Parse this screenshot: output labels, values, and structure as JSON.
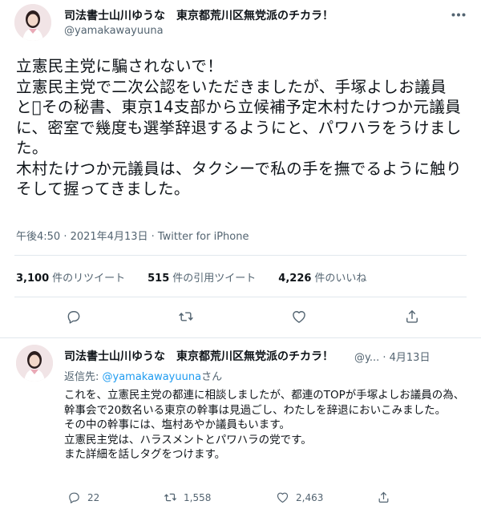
{
  "main": {
    "display_name": "司法書士山川ゆうな　東京都荒川区無党派のチカラ！",
    "handle": "@yamakawayuuna",
    "text": "立憲民主党に騙されないで！\n立憲民主党で二次公認をいただきましたが、手塚よしお議員と\u0000その秘書、東京14支部から立候補予定木村たけつか元議員に、密室で幾度も選挙辞退するようにと、パワハラをうけました。\n木村たけつか元議員は、タクシーで私の手を撫でるように触りそして握ってきました。",
    "meta": "午後4:50 · 2021年4月13日 · Twitter for iPhone",
    "stats": {
      "retweets_count": "3,100",
      "retweets_label": "件のリツイート",
      "quotes_count": "515",
      "quotes_label": "件の引用ツイート",
      "likes_count": "4,226",
      "likes_label": "件のいいね"
    },
    "actions": [
      "reply-icon",
      "retweet-icon",
      "like-icon",
      "share-icon"
    ]
  },
  "reply": {
    "display_name": "司法書士山川ゆうな　東京都荒川区無党派のチカラ！",
    "handle_date": "@y... · 4月13日",
    "reply_to_prefix": "返信先: ",
    "reply_to_handle": "@yamakawayuuna",
    "reply_to_suffix": "さん",
    "text": "これを、立憲民主党の都連に相談しましたが、都連のTOPが手塚よしお議員の為、幹事会で20数名いる東京の幹事は見過ごし、わたしを辞退においこみました。\nその中の幹事には、塩村あやか議員もいます。\n立憲民主党は、ハラスメントとパワハラの党です。\nまた詳細を話しタグをつけます。",
    "reply_count": "22",
    "retweet_count": "1,558",
    "like_count": "2,463"
  },
  "colors": {
    "text": "#0f1419",
    "secondary": "#536471",
    "link": "#1d9bf0",
    "border": "#e1e8ed"
  }
}
